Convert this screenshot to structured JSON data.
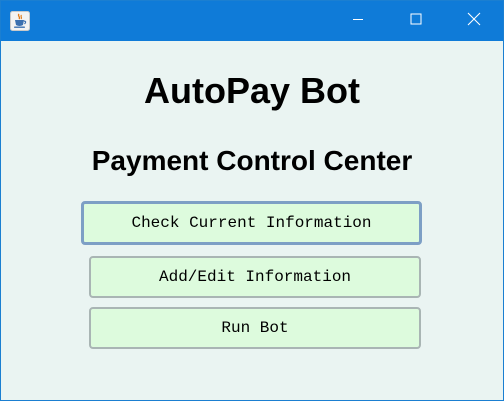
{
  "window": {
    "icon": "java-coffee-cup-icon"
  },
  "titlebar": {
    "minimize_icon": "minimize-icon",
    "maximize_icon": "maximize-icon",
    "close_icon": "close-icon"
  },
  "main": {
    "title": "AutoPay Bot",
    "subtitle": "Payment Control Center",
    "buttons": [
      {
        "label": "Check Current Information"
      },
      {
        "label": "Add/Edit Information"
      },
      {
        "label": "Run Bot"
      }
    ]
  },
  "colors": {
    "titlebar": "#0f7bd8",
    "background": "#eaf4f2",
    "button_fill": "#ddfbdd",
    "button_border": "#a9b5b4",
    "focus_border": "#7d9fc5"
  }
}
